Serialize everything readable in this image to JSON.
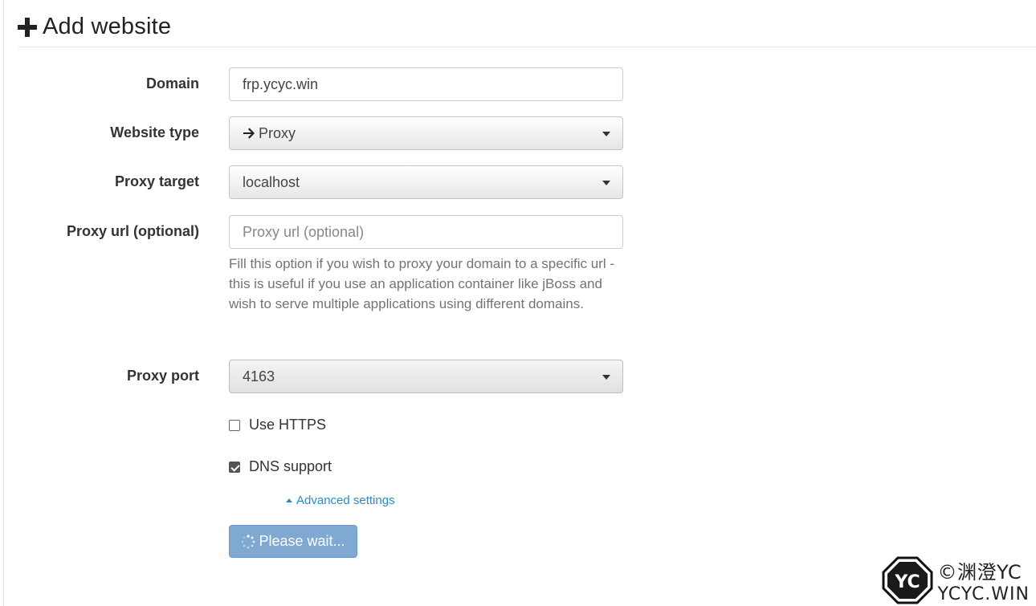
{
  "header": {
    "title": "Add website",
    "icon": "plus-icon"
  },
  "form": {
    "domain": {
      "label": "Domain",
      "value": "frp.ycyc.win"
    },
    "website_type": {
      "label": "Website type",
      "value": "Proxy",
      "icon": "arrow-right-icon"
    },
    "proxy_target": {
      "label": "Proxy target",
      "value": "localhost"
    },
    "proxy_url": {
      "label": "Proxy url (optional)",
      "placeholder": "Proxy url (optional)",
      "help": "Fill this option if you wish to proxy your domain to a specific url - this is useful if you use an application container like jBoss and wish to serve multiple applications using different domains."
    },
    "proxy_port": {
      "label": "Proxy port",
      "value": "4163"
    },
    "use_https": {
      "label": "Use HTTPS",
      "checked": false
    },
    "dns_support": {
      "label": "DNS support",
      "checked": true
    },
    "advanced_link": "Advanced settings",
    "submit": {
      "label": "Please wait...",
      "icon": "spinner-icon"
    }
  },
  "watermark": {
    "badge": "YC",
    "line1": "©渊澄YC",
    "line2": "YCYC.WIN"
  },
  "colors": {
    "accent": "#2b8cc4",
    "button_disabled": "#7fa9d0"
  }
}
